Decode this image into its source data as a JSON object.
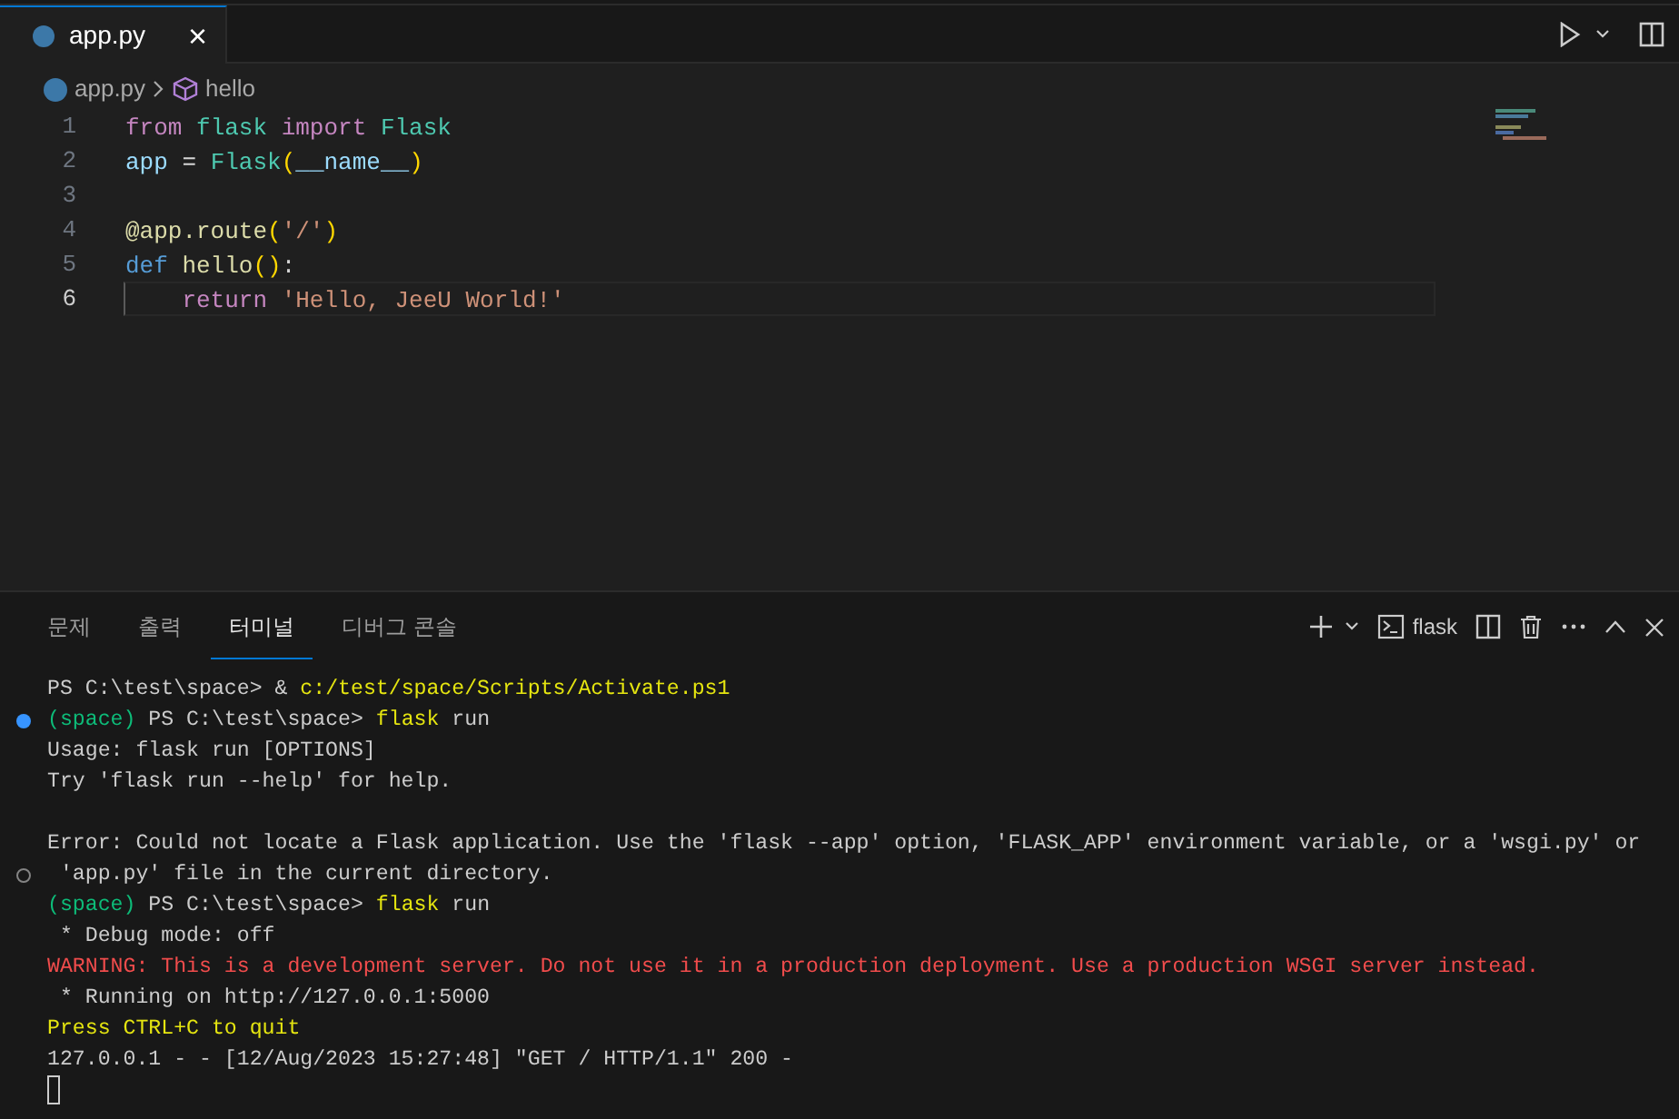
{
  "editor_tabs": [
    {
      "label": "app.py",
      "selected": true,
      "close": "×"
    }
  ],
  "breadcrumb": {
    "file": "app.py",
    "symbol": "hello"
  },
  "code": {
    "lines": [
      {
        "number": "1",
        "current": false,
        "tokens": [
          {
            "text": "from",
            "kind": "keyword"
          },
          {
            "text": " flask",
            "kind": "module"
          },
          {
            "text": " import",
            "kind": "keyword"
          },
          {
            "text": " Flask",
            "kind": "class"
          }
        ]
      },
      {
        "number": "2",
        "current": false,
        "tokens": [
          {
            "text": "app",
            "kind": "variable"
          },
          {
            "text": " = "
          },
          {
            "text": "Flask",
            "kind": "class"
          },
          {
            "text": "(",
            "kind": "bracket"
          },
          {
            "text": "__name__",
            "kind": "variable"
          },
          {
            "text": ")",
            "kind": "bracket"
          }
        ]
      },
      {
        "number": "3",
        "current": false
      },
      {
        "number": "4",
        "current": false,
        "tokens": [
          {
            "text": "@app.route",
            "kind": "decorator"
          },
          {
            "text": "(",
            "kind": "bracket"
          },
          {
            "text": "'/'",
            "kind": "string"
          },
          {
            "text": ")",
            "kind": "bracket"
          }
        ]
      },
      {
        "number": "5",
        "current": false,
        "tokens": [
          {
            "text": "def",
            "kind": "storage"
          },
          {
            "text": " hello",
            "kind": "function"
          },
          {
            "text": "()",
            "kind": "bracket"
          },
          {
            "text": ":"
          }
        ]
      },
      {
        "number": "6",
        "current": true,
        "tokens": [
          {
            "text": "    return",
            "kind": "keyword"
          },
          {
            "text": " 'Hello, JeeU World!'",
            "kind": "string"
          }
        ]
      }
    ]
  },
  "panel_tabs": [
    {
      "label": "문제",
      "selected": false
    },
    {
      "label": "출력",
      "selected": false
    },
    {
      "label": "터미널",
      "selected": true
    },
    {
      "label": "디버그 콘솔",
      "selected": false
    }
  ],
  "terminal_name": "flask",
  "terminal": [
    {
      "segments": [
        {
          "text": "PS C:\\test\\space> & "
        },
        {
          "text": "c:/test/space/Scripts/Activate.ps1",
          "kind": "command"
        }
      ]
    },
    {
      "succeeded": true,
      "segments": [
        {
          "text": "(space)",
          "kind": "env"
        },
        {
          "text": " PS C:\\test\\space> "
        },
        {
          "text": "flask",
          "kind": "command"
        },
        {
          "text": " run"
        }
      ]
    },
    {
      "segments": [
        {
          "text": "Usage: flask run [OPTIONS]"
        }
      ]
    },
    {
      "segments": [
        {
          "text": "Try 'flask run --help' for help."
        }
      ]
    },
    {
      "kind": "blank"
    },
    {
      "segments": [
        {
          "text": "Error: Could not locate a Flask application. Use the 'flask --app' option, 'FLASK_APP' environment variable, or a 'wsgi.py' or"
        }
      ]
    },
    {
      "succeeded": false,
      "segments": [
        {
          "text": " 'app.py' file in the current directory."
        }
      ]
    },
    {
      "segments": [
        {
          "text": "(space)",
          "kind": "env"
        },
        {
          "text": " PS C:\\test\\space> "
        },
        {
          "text": "flask",
          "kind": "command"
        },
        {
          "text": " run"
        }
      ]
    },
    {
      "segments": [
        {
          "text": " * Debug mode: off"
        }
      ]
    },
    {
      "segments": [
        {
          "text": "WARNING: This is a development server. Do not use it in a production deployment. Use a production WSGI server instead.",
          "kind": "warning"
        }
      ]
    },
    {
      "segments": [
        {
          "text": " * Running on http://127.0.0.1:5000"
        }
      ]
    },
    {
      "segments": [
        {
          "text": "Press CTRL+C to quit",
          "kind": "command"
        }
      ]
    },
    {
      "segments": [
        {
          "text": "127.0.0.1 - - [12/Aug/2023 15:27:48] \"GET / HTTP/1.1\" 200 -"
        }
      ]
    }
  ]
}
